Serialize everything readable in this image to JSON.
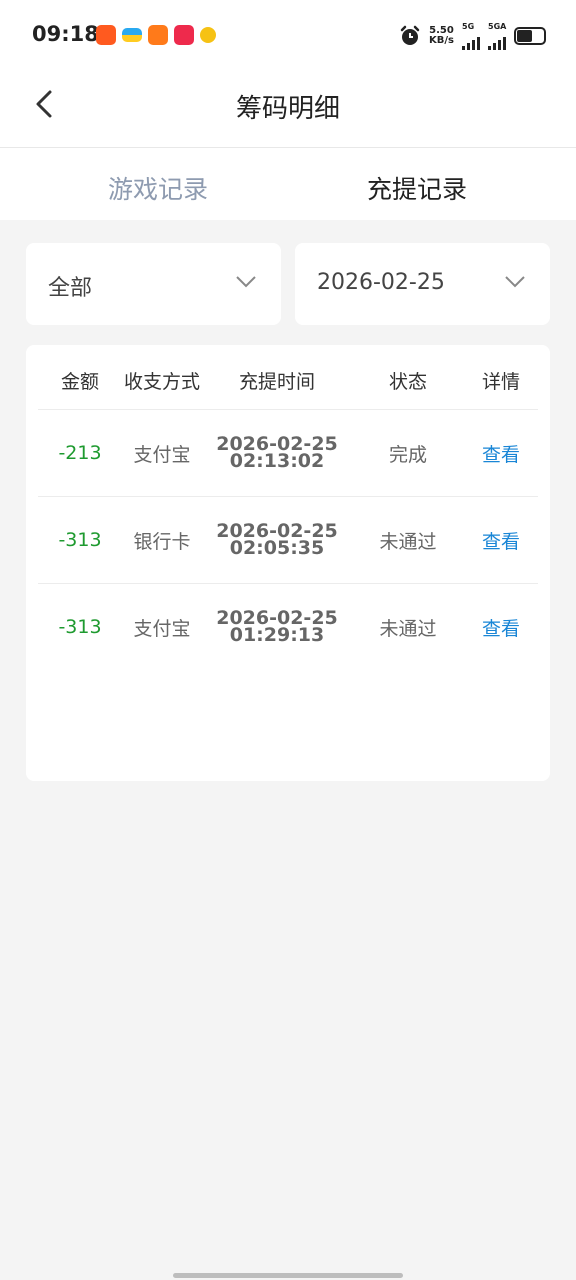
{
  "status": {
    "time": "09:18",
    "speed_value": "5.50",
    "speed_unit": "KB/s",
    "sim1_label": "5G",
    "sim2_label": "5GA"
  },
  "nav": {
    "title": "筹码明细"
  },
  "tabs": [
    {
      "label": "游戏记录",
      "active": false
    },
    {
      "label": "充提记录",
      "active": true
    }
  ],
  "filters": {
    "type": "全部",
    "date": "2026-02-25"
  },
  "table": {
    "headers": [
      "金额",
      "收支方式",
      "充提时间",
      "状态",
      "详情"
    ],
    "rows": [
      {
        "amount": "-213",
        "method": "支付宝",
        "date": "2026-02-25",
        "time": "02:13:02",
        "status": "完成",
        "detail": "查看"
      },
      {
        "amount": "-313",
        "method": "银行卡",
        "date": "2026-02-25",
        "time": "02:05:35",
        "status": "未通过",
        "detail": "查看"
      },
      {
        "amount": "-313",
        "method": "支付宝",
        "date": "2026-02-25",
        "time": "01:29:13",
        "status": "未通过",
        "detail": "查看"
      }
    ]
  },
  "colors": {
    "amount": "#1e9a2f",
    "link": "#1a86d6",
    "inactive_tab": "#8e9bb0"
  }
}
